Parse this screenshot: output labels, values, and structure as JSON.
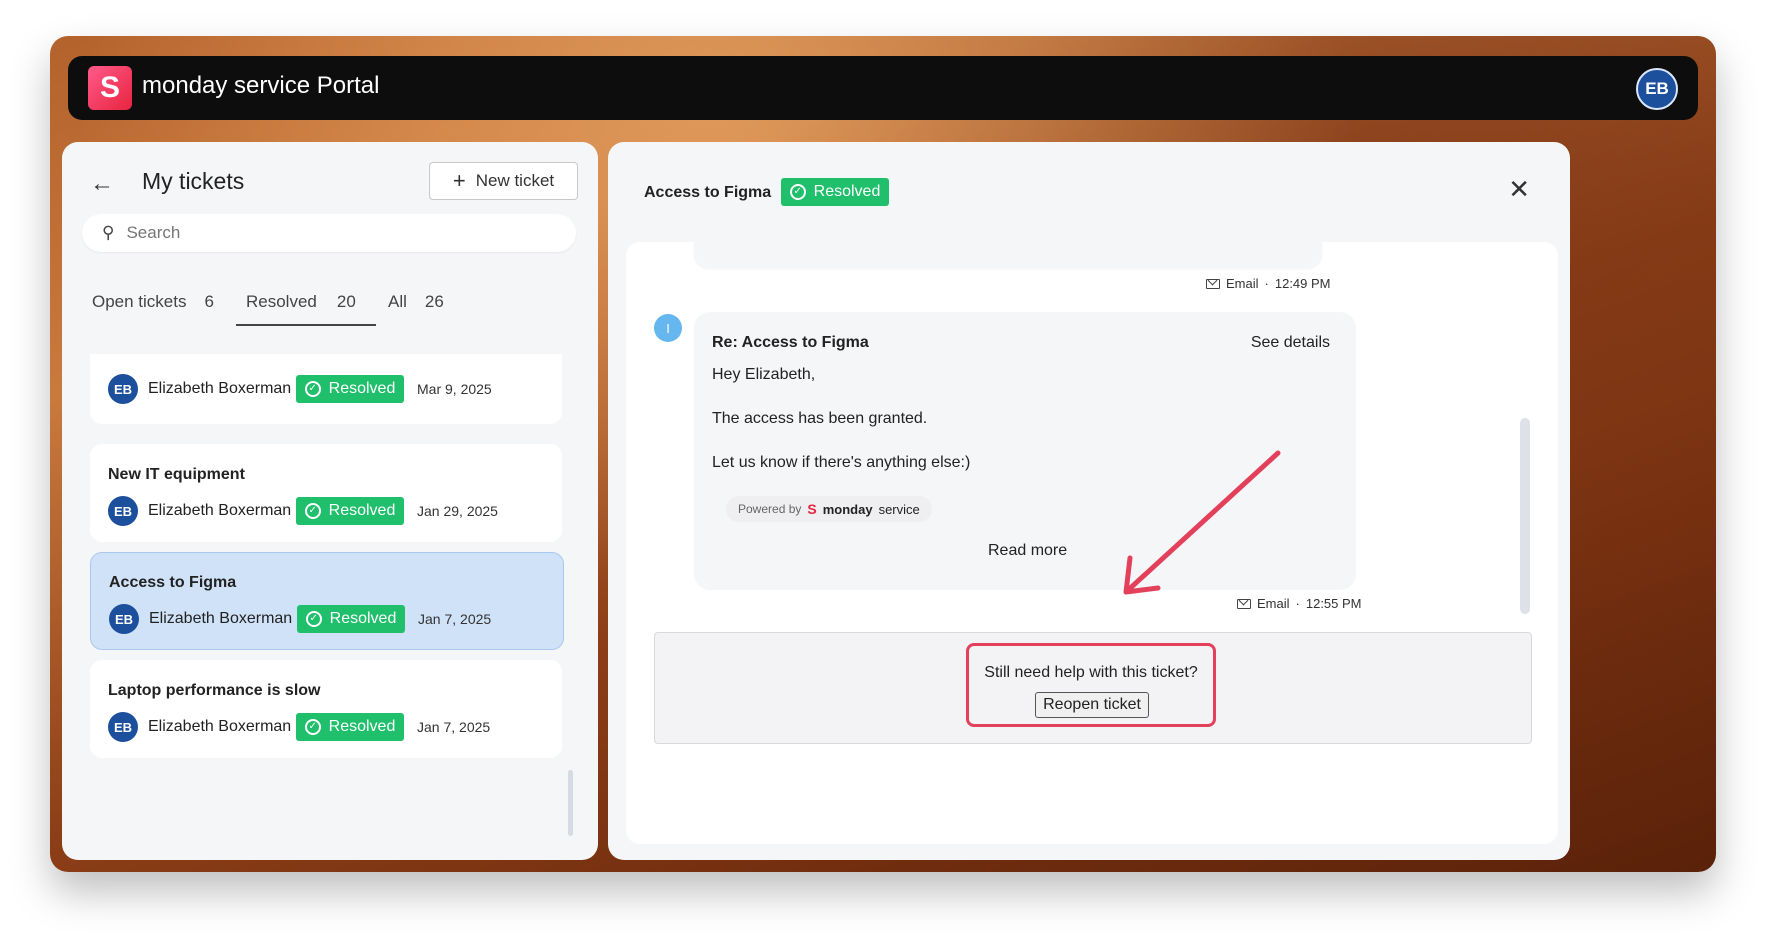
{
  "app": {
    "logo_letter": "S",
    "title": "monday service Portal",
    "user_initials": "EB"
  },
  "left": {
    "title": "My tickets",
    "new_ticket_label": "New ticket",
    "search_placeholder": "Search",
    "tabs": [
      {
        "label": "Open tickets",
        "count": "6"
      },
      {
        "label": "Resolved",
        "count": "20"
      },
      {
        "label": "All",
        "count": "26"
      }
    ],
    "tickets": [
      {
        "title": "",
        "author": "Elizabeth Boxerman",
        "initials": "EB",
        "status": "Resolved",
        "date": "Mar 9, 2025"
      },
      {
        "title": "New IT equipment",
        "author": "Elizabeth Boxerman",
        "initials": "EB",
        "status": "Resolved",
        "date": "Jan 29, 2025"
      },
      {
        "title": "Access to Figma",
        "author": "Elizabeth Boxerman",
        "initials": "EB",
        "status": "Resolved",
        "date": "Jan 7, 2025"
      },
      {
        "title": "Laptop performance is slow",
        "author": "Elizabeth Boxerman",
        "initials": "EB",
        "status": "Resolved",
        "date": "Jan 7, 2025"
      }
    ]
  },
  "detail": {
    "title": "Access to Figma",
    "status": "Resolved",
    "prev_meta": {
      "channel": "Email",
      "time": "12:49 PM"
    },
    "message": {
      "sender_initial": "I",
      "subject": "Re: Access to Figma",
      "see_details": "See details",
      "lines": [
        "Hey Elizabeth,",
        "The access has been granted.",
        "Let us know if there's anything else:)"
      ],
      "powered_by": "Powered by",
      "powered_brand": "monday",
      "powered_service": "service",
      "read_more": "Read more",
      "channel": "Email",
      "time": "12:55 PM"
    },
    "reopen": {
      "prompt": "Still need help with this ticket?",
      "button": "Reopen ticket"
    }
  },
  "colors": {
    "resolved": "#1fbf6b",
    "avatar": "#1c4f9c",
    "highlight": "#e3415b",
    "selected": "#cfe2f8"
  }
}
